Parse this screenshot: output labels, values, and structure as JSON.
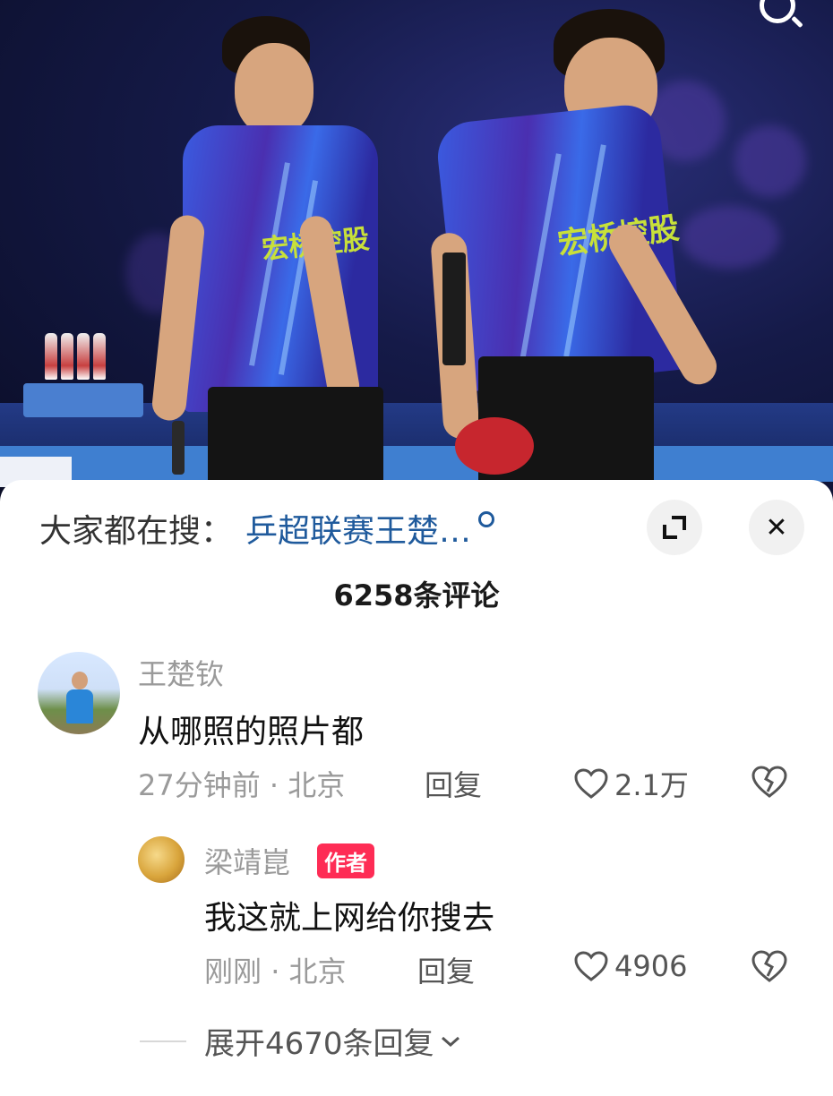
{
  "search_bar": {
    "prefix": "大家都在搜：",
    "keyword": "乒超联赛王楚…"
  },
  "comment_count": "6258条评论",
  "photo": {
    "sponsor_text": "宏桥控股"
  },
  "comments": [
    {
      "username": "王楚钦",
      "text": "从哪照的照片都",
      "time": "27分钟前",
      "location": "北京",
      "reply_label": "回复",
      "likes": "2.1万"
    }
  ],
  "replies": [
    {
      "username": "梁靖崑",
      "badge": "作者",
      "text": "我这就上网给你搜去",
      "time": "刚刚",
      "location": "北京",
      "reply_label": "回复",
      "likes": "4906"
    }
  ],
  "expand_replies_label": "展开4670条回复",
  "colors": {
    "accent_red": "#fe2c55",
    "link_blue": "#1f5a9c",
    "muted_gray": "#9a9a9a"
  }
}
